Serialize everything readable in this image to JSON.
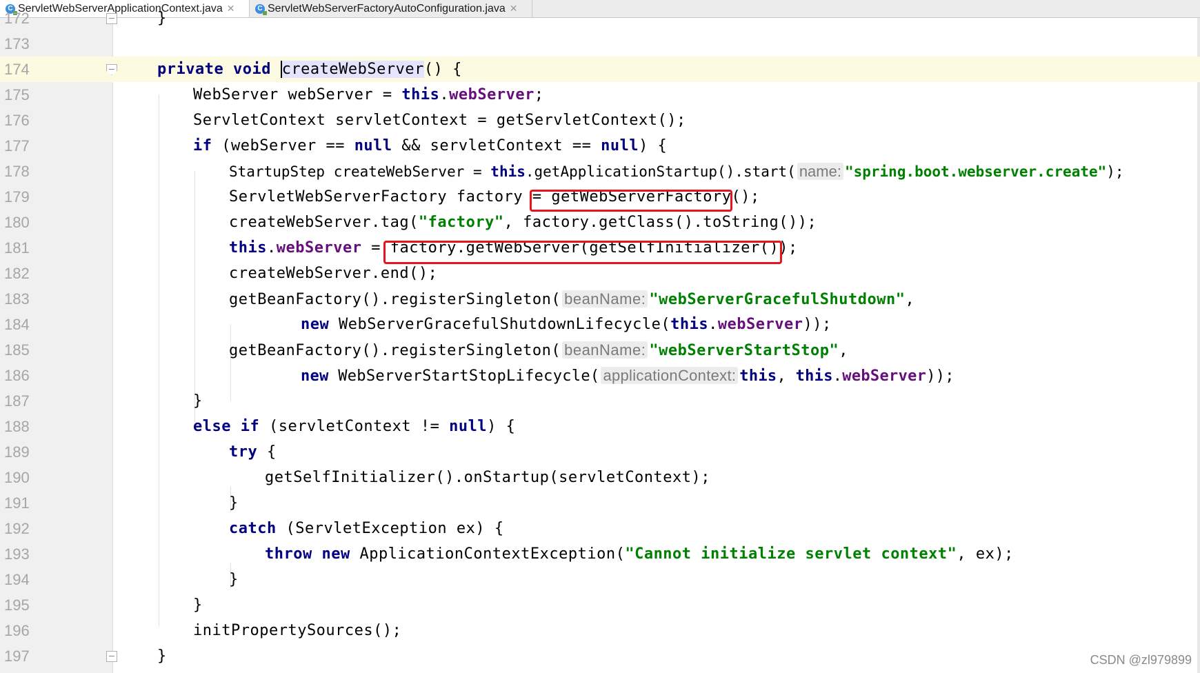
{
  "tabs": [
    {
      "label": "ServletWebServerApplicationContext.java",
      "active": true,
      "icon": "java-class-icon"
    },
    {
      "label": "ServletWebServerFactoryAutoConfiguration.java",
      "active": false,
      "icon": "java-class-icon"
    }
  ],
  "editor": {
    "caret_line": "174",
    "lines": [
      {
        "n": "172",
        "t": "}"
      },
      {
        "n": "173",
        "t": ""
      },
      {
        "n": "174",
        "t": "private void createWebServer() {"
      },
      {
        "n": "175",
        "t": "WebServer webServer = this.webServer;"
      },
      {
        "n": "176",
        "t": "ServletContext servletContext = getServletContext();"
      },
      {
        "n": "177",
        "t": "if (webServer == null && servletContext == null) {"
      },
      {
        "n": "178",
        "t": "StartupStep createWebServer = this.getApplicationStartup().start( name: \"spring.boot.webserver.create\");"
      },
      {
        "n": "179",
        "t": "ServletWebServerFactory factory = getWebServerFactory();"
      },
      {
        "n": "180",
        "t": "createWebServer.tag(\"factory\", factory.getClass().toString());"
      },
      {
        "n": "181",
        "t": "this.webServer = factory.getWebServer(getSelfInitializer());"
      },
      {
        "n": "182",
        "t": "createWebServer.end();"
      },
      {
        "n": "183",
        "t": "getBeanFactory().registerSingleton( beanName: \"webServerGracefulShutdown\","
      },
      {
        "n": "184",
        "t": "new WebServerGracefulShutdownLifecycle(this.webServer));"
      },
      {
        "n": "185",
        "t": "getBeanFactory().registerSingleton( beanName: \"webServerStartStop\","
      },
      {
        "n": "186",
        "t": "new WebServerStartStopLifecycle( applicationContext: this, this.webServer));"
      },
      {
        "n": "187",
        "t": "}"
      },
      {
        "n": "188",
        "t": "else if (servletContext != null) {"
      },
      {
        "n": "189",
        "t": "try {"
      },
      {
        "n": "190",
        "t": "getSelfInitializer().onStartup(servletContext);"
      },
      {
        "n": "191",
        "t": "}"
      },
      {
        "n": "192",
        "t": "catch (ServletException ex) {"
      },
      {
        "n": "193",
        "t": "throw new ApplicationContextException(\"Cannot initialize servlet context\", ex);"
      },
      {
        "n": "194",
        "t": "}"
      },
      {
        "n": "195",
        "t": "}"
      },
      {
        "n": "196",
        "t": "initPropertySources();"
      },
      {
        "n": "197",
        "t": "}"
      }
    ],
    "hints": {
      "name": "name:",
      "beanName": "beanName:",
      "applicationContext": "applicationContext:"
    },
    "highlights": [
      "getWebServerFactory();",
      "factory.getWebServer(getSelfInitializer());"
    ]
  },
  "colors": {
    "keyword": "#000080",
    "field": "#660e7a",
    "string": "#008000",
    "highlight_box": "#e5151f",
    "gutter": "#f0f0f0",
    "caret_line": "#fcfae1"
  },
  "watermark": "CSDN @zl979899"
}
